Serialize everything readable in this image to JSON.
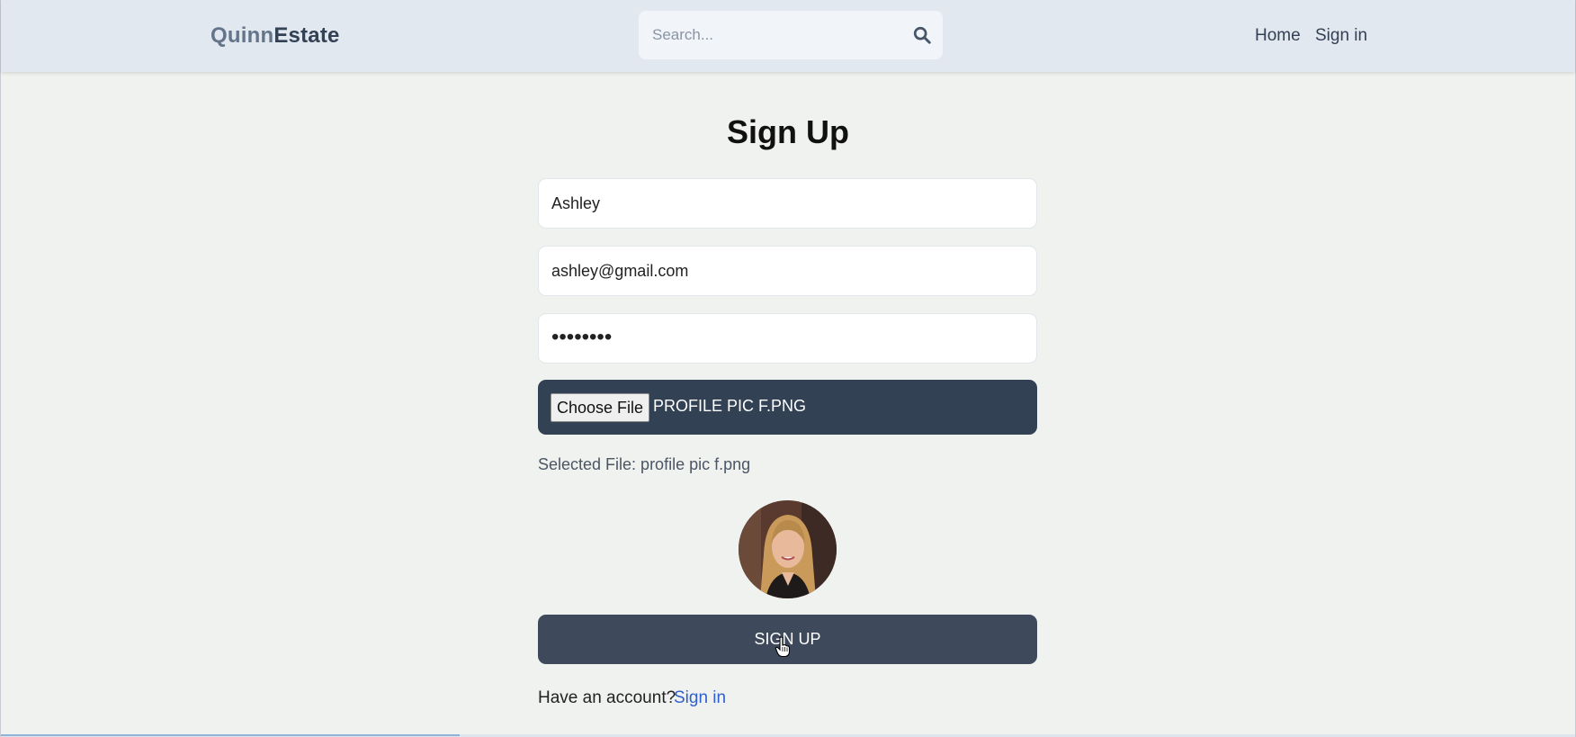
{
  "header": {
    "logo_part1": "Quinn",
    "logo_part2": "Estate",
    "search_placeholder": "Search...",
    "nav": {
      "home": "Home",
      "sign_in": "Sign in"
    }
  },
  "form": {
    "title": "Sign Up",
    "username_value": "Ashley",
    "email_value": "ashley@gmail.com",
    "password_masked": "••••••••",
    "file_button": "Choose File",
    "file_name": "PROFILE PIC F.PNG",
    "selected_file": "Selected File: profile pic f.png",
    "submit_label": "SIGN UP",
    "footer_text": "Have an account?",
    "footer_link": "Sign in"
  },
  "colors": {
    "header_bg": "#e2e8f0",
    "page_bg": "#f0f2ef",
    "primary": "#334155",
    "link": "#2f5fcf"
  },
  "icons": [
    "search-icon",
    "avatar",
    "pointer-cursor-icon"
  ]
}
